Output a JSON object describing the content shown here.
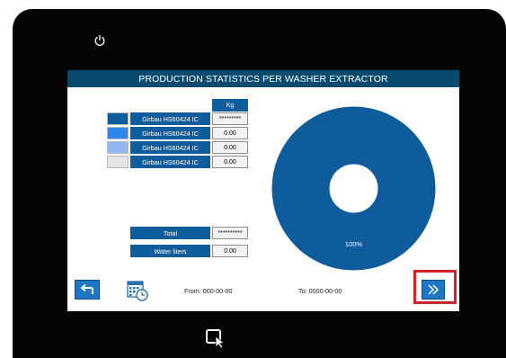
{
  "screen": {
    "title": "PRODUCTION STATISTICS PER WASHER EXTRACTOR"
  },
  "table": {
    "column_header": "Kg",
    "rows": [
      {
        "label": "Girbau HS60424 IC",
        "value": "*********",
        "color": "#0e5c9c"
      },
      {
        "label": "Girbau HS60424 IC",
        "value": "0.00",
        "color": "#2f86ec"
      },
      {
        "label": "Girbau HS60424 IC",
        "value": "0.00",
        "color": "#8fb8f0"
      },
      {
        "label": "Girbau HS60424 IC",
        "value": "0.00",
        "color": "#e4e4e4"
      }
    ]
  },
  "summary": {
    "total_label": "Total",
    "total_value": "**********",
    "water_label": "Water liters",
    "water_value": "0.00"
  },
  "chart_data": {
    "type": "pie",
    "values": [
      100
    ],
    "colors": [
      "#0e5c9c"
    ],
    "labels": [
      "100%"
    ]
  },
  "footer": {
    "from_text": "From: 000-00-00",
    "to_text": "To: 0000-00-00"
  },
  "icons": {
    "power": "power-icon",
    "back": "back-arrow-icon",
    "calendar": "calendar-clock-icon",
    "next": "double-chevron-right-icon",
    "bottom": "window-cursor-icon"
  },
  "colors": {
    "accent": "#0e5c9c",
    "titlebar": "#0a4a6e",
    "highlight": "#d4202a"
  }
}
